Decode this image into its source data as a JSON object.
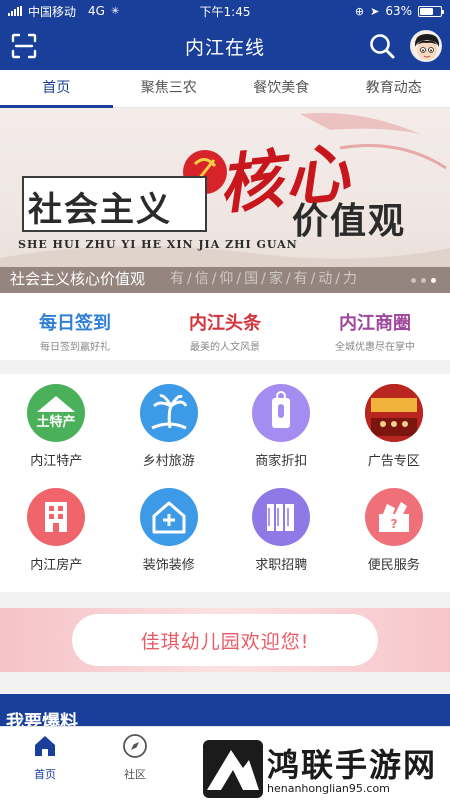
{
  "status_bar": {
    "carrier": "中国移动",
    "network": "4G",
    "time": "下午1:45",
    "battery": "63%",
    "battery_level": 0.63
  },
  "header": {
    "title": "内江在线"
  },
  "tabs": [
    {
      "label": "首页",
      "active": true
    },
    {
      "label": "聚焦三农",
      "active": false
    },
    {
      "label": "餐饮美食",
      "active": false
    },
    {
      "label": "教育动态",
      "active": false
    }
  ],
  "banner": {
    "box_text": "社会主义",
    "big_text": "核心",
    "sub_text": "价值观",
    "pinyin": "SHE HUI ZHU YI HE XIN JIA ZHI GUAN",
    "caption": "社会主义核心价值观",
    "ghost_text": "有/信/仰/国/家/有/动/力"
  },
  "quick_links": [
    {
      "title": "每日签到",
      "subtitle": "每日签到赢好礼",
      "color": "#2f7fd6"
    },
    {
      "title": "内江头条",
      "subtitle": "最美的人文风景",
      "color": "#d4343b"
    },
    {
      "title": "内江商圈",
      "subtitle": "全城优惠尽在掌中",
      "color": "#a0459c"
    }
  ],
  "services": [
    {
      "label": "内江特产",
      "icon": "specialty-icon",
      "color": "#4bb05a"
    },
    {
      "label": "乡村旅游",
      "icon": "palm-tree-icon",
      "color": "#3d9ae6"
    },
    {
      "label": "商家折扣",
      "icon": "tap-icon",
      "color": "#a58cf0"
    },
    {
      "label": "广告专区",
      "icon": "ad-photo-icon",
      "color": "#c9382e"
    },
    {
      "label": "内江房产",
      "icon": "building-icon",
      "color": "#f0646c"
    },
    {
      "label": "装饰装修",
      "icon": "house-plus-icon",
      "color": "#3d9ae6"
    },
    {
      "label": "求职招聘",
      "icon": "books-icon",
      "color": "#8e79e6"
    },
    {
      "label": "便民服务",
      "icon": "toolbox-icon",
      "color": "#f07079"
    }
  ],
  "promo": {
    "text": "佳琪幼儿园欢迎您!"
  },
  "report": {
    "title": "我要爆料"
  },
  "bottom_nav": [
    {
      "label": "首页",
      "icon": "home-icon",
      "active": true
    },
    {
      "label": "社区",
      "icon": "compass-icon",
      "active": false
    }
  ],
  "watermark": {
    "name": "鸿联手游网",
    "url": "henanhonglian95.com"
  }
}
